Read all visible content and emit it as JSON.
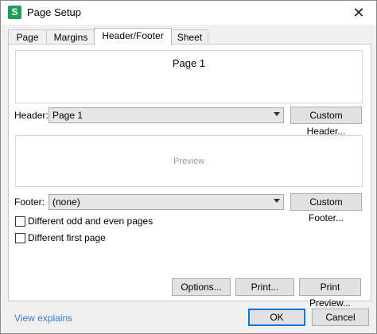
{
  "window": {
    "title": "Page Setup",
    "app_icon_letter": "S",
    "close_glyph": "✕"
  },
  "tabs": [
    {
      "label": "Page"
    },
    {
      "label": "Margins"
    },
    {
      "label": "Header/Footer",
      "active": true
    },
    {
      "label": "Sheet"
    }
  ],
  "header_preview": {
    "text": "Page 1"
  },
  "header": {
    "label": "Header:",
    "value": "Page 1",
    "custom_button": "Custom Header..."
  },
  "middle_preview": {
    "text": "Preview"
  },
  "footer": {
    "label": "Footer:",
    "value": "(none)",
    "custom_button": "Custom Footer..."
  },
  "options": [
    {
      "label": "Different odd and even pages",
      "checked": false
    },
    {
      "label": "Different first page",
      "checked": false
    }
  ],
  "buttons": {
    "options": "Options...",
    "print": "Print...",
    "print_preview": "Print Preview..."
  },
  "footer_bar": {
    "link": "View explains",
    "ok": "OK",
    "cancel": "Cancel"
  },
  "colors": {
    "accent": "#0078d7",
    "app_icon": "#1f9d55",
    "link": "#3c78d8"
  }
}
